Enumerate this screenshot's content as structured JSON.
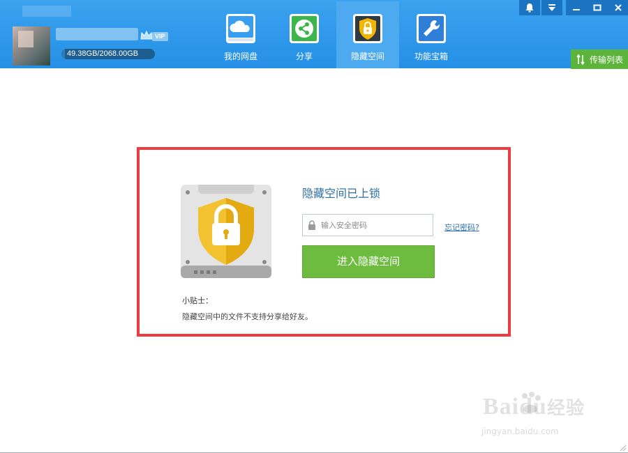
{
  "user": {
    "vip_label": "VIP",
    "storage_text": "49.38GB/2068.00GB",
    "storage_used_fraction": 0.024
  },
  "tabs": [
    {
      "label": "我的网盘",
      "icon": "cloud-drive-icon",
      "active": false
    },
    {
      "label": "分享",
      "icon": "share-icon",
      "active": false
    },
    {
      "label": "隐藏空间",
      "icon": "shield-lock-icon",
      "active": true
    },
    {
      "label": "功能宝箱",
      "icon": "wrench-toolbox-icon",
      "active": false
    }
  ],
  "window_controls": [
    "bell-icon",
    "dropdown-menu-icon",
    "minimize-icon",
    "maximize-icon",
    "close-icon"
  ],
  "transfer_button": {
    "label": "传输列表",
    "icon": "transfer-arrows-icon"
  },
  "hidden_space": {
    "title": "隐藏空间已上锁",
    "password_placeholder": "输入安全密码",
    "password_value": "",
    "forgot_link": "忘记密码?",
    "enter_button": "进入隐藏空间",
    "tip_title": "小贴士：",
    "tip_text": "隐藏空间中的文件不支持分享给好友。"
  },
  "watermark": {
    "brand": "Baidu",
    "cn": "经验",
    "url": "jingyan.baidu.com"
  },
  "colors": {
    "header_blue": "#2a95e8",
    "active_tab": "#4eaaf0",
    "green_button": "#6dbb3f",
    "transfer_green": "#5db43a",
    "highlight_red": "#ee3b40",
    "shield_gold": "#f2b600"
  }
}
